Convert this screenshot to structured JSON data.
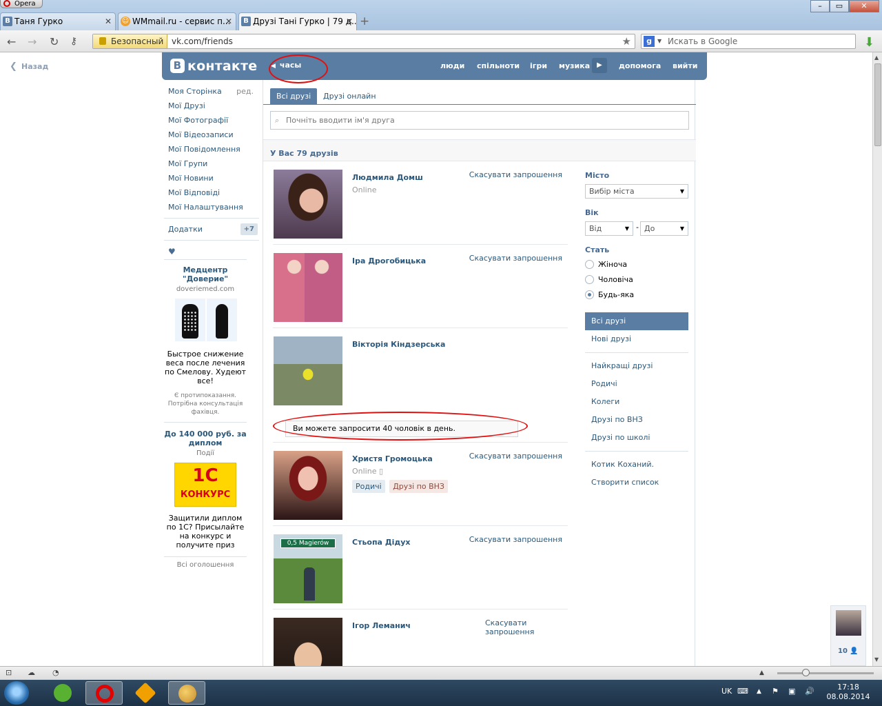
{
  "browser": {
    "app_name": "Opera",
    "tabs": [
      {
        "label": "Таня Гурко",
        "favicon": "В"
      },
      {
        "label": "WMmail.ru - сервис п...",
        "favicon": "☺"
      },
      {
        "label": "Друзі Тані Гурко | 79 д...",
        "favicon": "В"
      }
    ],
    "security_label": "Безопасный",
    "url": "vk.com/friends",
    "search_placeholder": "Искать в Google",
    "search_engine_icon": "g"
  },
  "page": {
    "back_label": "Назад",
    "header": {
      "logo_text": "контакте",
      "logo_letter": "В",
      "back_section": "часы",
      "nav": [
        "люди",
        "спільноти",
        "ігри",
        "музика",
        "допомога",
        "вийти"
      ]
    },
    "left_menu": {
      "items": [
        "Моя Сторінка",
        "Мої Друзі",
        "Мої Фотографії",
        "Мої Відеозаписи",
        "Мої Повідомлення",
        "Мої Групи",
        "Мої Новини",
        "Мої Відповіді",
        "Мої Налаштування"
      ],
      "edit_label": "ред.",
      "apps_label": "Додатки",
      "apps_badge": "+7"
    },
    "ads": {
      "ad1": {
        "title": "Медцентр \"Доверие\"",
        "domain": "doveriemed.com",
        "text": "Быстрое снижение веса после лечения по Смелову. Худеют все!",
        "note": "Є протипоказання. Потрібна консультація фахівця."
      },
      "ad2": {
        "title": "До 140 000 руб. за диплом",
        "category": "Події",
        "logo_top": "1С",
        "logo_bottom": "КОНКУРС",
        "text": "Защитили диплом по 1С? Присылайте на конкурс и получите приз"
      },
      "all_ads": "Всі оголошення"
    },
    "tabs": [
      "Всі друзі",
      "Друзі онлайн"
    ],
    "search_placeholder": "Почніть вводити ім'я друга",
    "friends_count_label": "У Вас 79 друзів",
    "cancel_label": "Скасувати запрошення",
    "friends": [
      {
        "name": "Людмила Домш",
        "status": "Online"
      },
      {
        "name": "Іра Дрогобицька"
      },
      {
        "name": "Вікторія Кіндзерська"
      },
      {
        "name": "Христя Громоцька",
        "status": "Online",
        "tags": [
          "Родичі",
          "Друзі по ВНЗ"
        ]
      },
      {
        "name": "Стьопа Дідух",
        "photo_sign": "0,5 Magierów"
      },
      {
        "name": "Ігор Леманич"
      }
    ],
    "limit_message": "Ви можете запросити 40 чоловік в день.",
    "filters": {
      "city_label": "Місто",
      "city_select": "Вибір міста",
      "age_label": "Вік",
      "age_from": "Від",
      "age_to": "До",
      "age_dash": "-",
      "sex_label": "Стать",
      "sex_options": [
        "Жіноча",
        "Чоловіча",
        "Будь-яка"
      ],
      "sex_selected": "Будь-яка",
      "lists": [
        "Всі друзі",
        "Нові друзі",
        "Найкращі друзі",
        "Родичі",
        "Колеги",
        "Друзі по ВНЗ",
        "Друзі по школі",
        "Котик Коханий.",
        "Створити список"
      ]
    },
    "im_count": "10"
  },
  "taskbar": {
    "lang": "UK",
    "time": "17:18",
    "date": "08.08.2014"
  },
  "colors": {
    "vk_blue": "#597da3",
    "link": "#2b587a",
    "annotation_red": "#e01010"
  }
}
